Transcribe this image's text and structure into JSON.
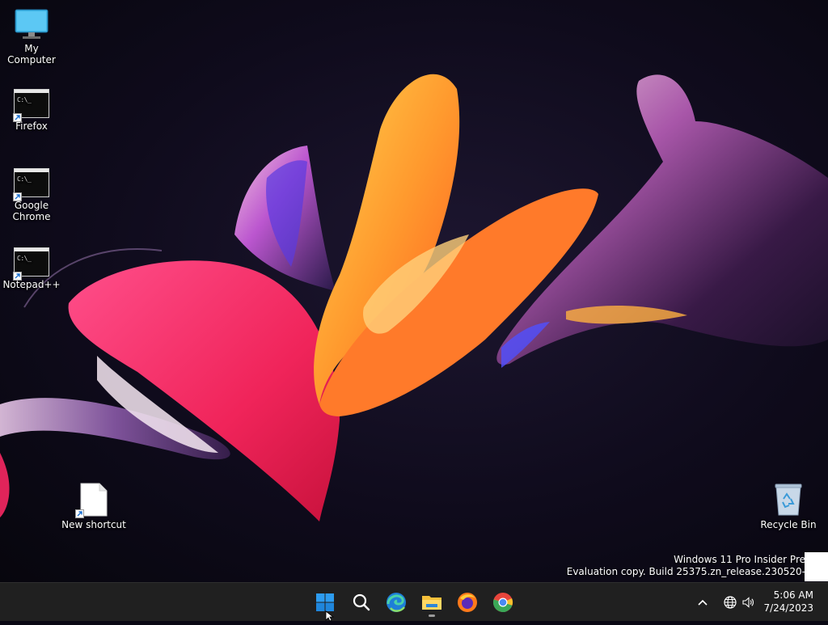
{
  "desktop": {
    "icons": [
      {
        "label": "My Computer",
        "icon": "monitor-icon"
      },
      {
        "label": "Firefox",
        "icon": "cmd-shortcut-icon"
      },
      {
        "label": "Google Chrome",
        "icon": "cmd-shortcut-icon"
      },
      {
        "label": "Notepad++",
        "icon": "cmd-shortcut-icon"
      },
      {
        "label": "New shortcut",
        "icon": "file-shortcut-icon"
      },
      {
        "label": "Recycle Bin",
        "icon": "recycle-bin-icon"
      }
    ],
    "cmd_prompt_text": "C:\\_"
  },
  "watermark": {
    "line1": "Windows 11 Pro Insider Pre",
    "line2": "Evaluation copy. Build 25375.zn_release.230520-"
  },
  "taskbar": {
    "items": [
      {
        "name": "start",
        "icon": "windows-start-icon"
      },
      {
        "name": "search",
        "icon": "search-icon"
      },
      {
        "name": "edge",
        "icon": "edge-icon"
      },
      {
        "name": "file-explorer",
        "icon": "folder-icon",
        "active": true
      },
      {
        "name": "firefox",
        "icon": "firefox-icon"
      },
      {
        "name": "chrome",
        "icon": "chrome-icon"
      }
    ],
    "tray": {
      "overflow_icon": "chevron-up-icon",
      "network_icon": "globe-icon",
      "volume_icon": "speaker-icon"
    },
    "clock": {
      "time": "5:06 AM",
      "date": "7/24/2023"
    }
  },
  "colors": {
    "taskbar_bg": "#202020",
    "accent": "#0078d4"
  }
}
